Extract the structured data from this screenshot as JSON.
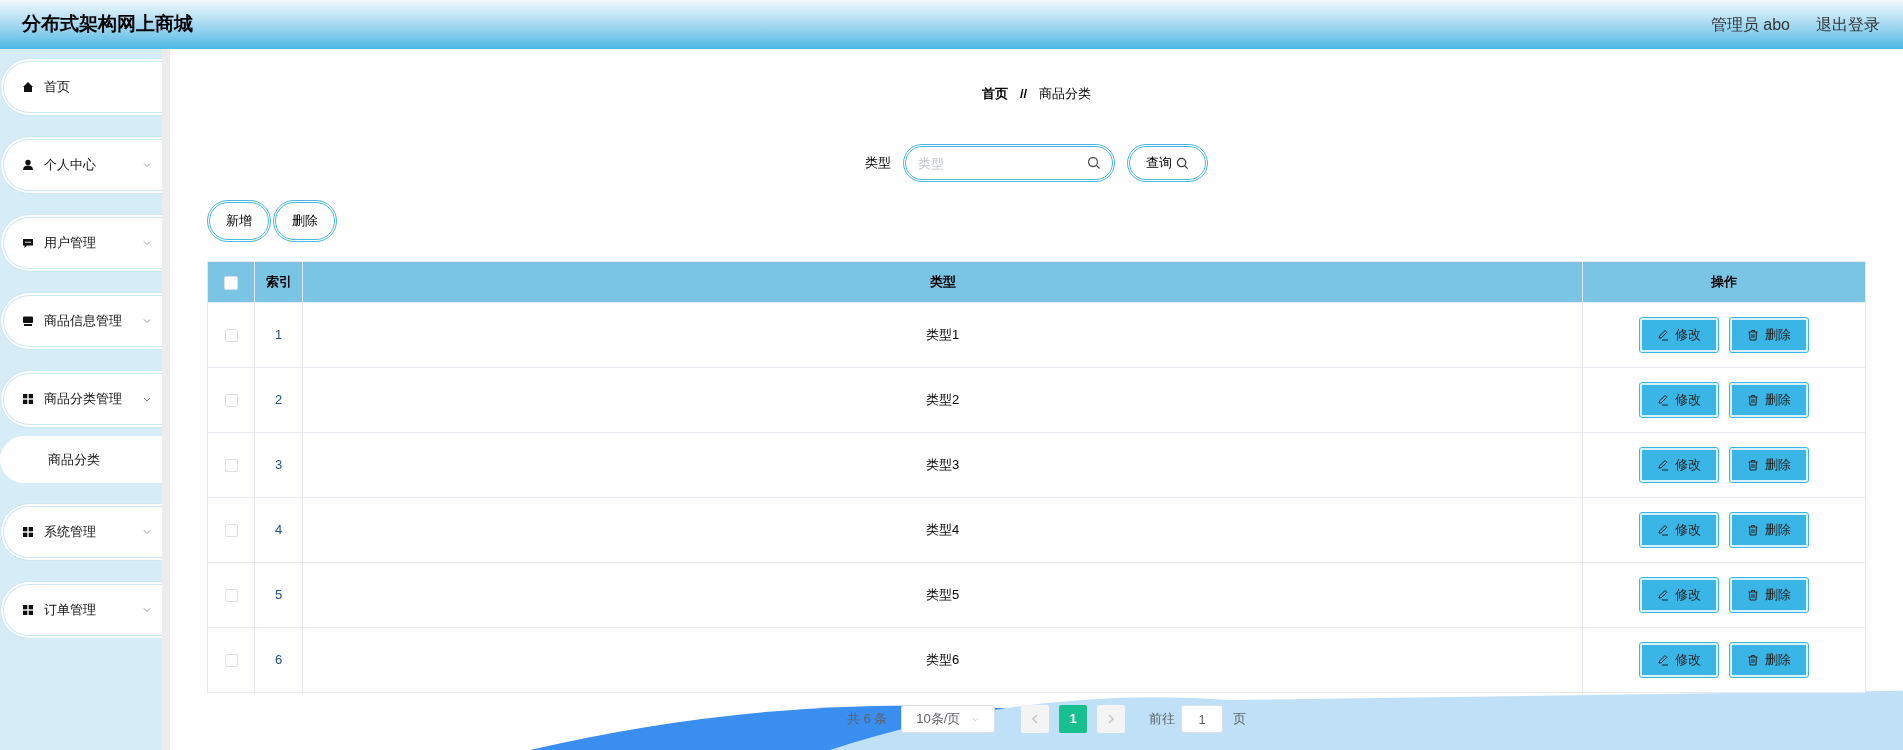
{
  "header": {
    "title": "分布式架构网上商城",
    "user": "管理员 abo",
    "logout": "退出登录"
  },
  "sidebar": {
    "items": [
      {
        "label": "首页",
        "kind": "link"
      },
      {
        "label": "个人中心",
        "kind": "submenu",
        "expanded": false
      },
      {
        "label": "用户管理",
        "kind": "submenu",
        "expanded": false
      },
      {
        "label": "商品信息管理",
        "kind": "submenu",
        "expanded": false
      },
      {
        "label": "商品分类管理",
        "kind": "submenu",
        "expanded": true,
        "children": [
          {
            "label": "商品分类"
          }
        ]
      },
      {
        "label": "系统管理",
        "kind": "submenu",
        "expanded": false
      },
      {
        "label": "订单管理",
        "kind": "submenu",
        "expanded": false
      }
    ]
  },
  "breadcrumb": {
    "items": [
      "首页",
      "商品分类"
    ],
    "separator": "//"
  },
  "search": {
    "label": "类型",
    "placeholder": "类型",
    "button": "查询"
  },
  "toolbar": {
    "buttons": [
      "新增",
      "删除"
    ]
  },
  "table": {
    "select_all_checked": false,
    "columns": [
      "索引",
      "类型",
      "操作"
    ],
    "rows": [
      {
        "checked": false,
        "index": "1",
        "type": "类型1",
        "actions": [
          "修改",
          "删除"
        ]
      },
      {
        "checked": false,
        "index": "2",
        "type": "类型2",
        "actions": [
          "修改",
          "删除"
        ]
      },
      {
        "checked": false,
        "index": "3",
        "type": "类型3",
        "actions": [
          "修改",
          "删除"
        ]
      },
      {
        "checked": false,
        "index": "4",
        "type": "类型4",
        "actions": [
          "修改",
          "删除"
        ]
      },
      {
        "checked": false,
        "index": "5",
        "type": "类型5",
        "actions": [
          "修改",
          "删除"
        ]
      },
      {
        "checked": false,
        "index": "6",
        "type": "类型6",
        "actions": [
          "修改",
          "删除"
        ]
      }
    ]
  },
  "pagination": {
    "total": "共 6 条",
    "page_size": "10条/页",
    "prev_disabled": true,
    "next_disabled": true,
    "pages": [
      {
        "label": "1",
        "selected": true
      }
    ],
    "goto_label": "前往",
    "goto_value": "1",
    "goto_suffix": "页"
  }
}
